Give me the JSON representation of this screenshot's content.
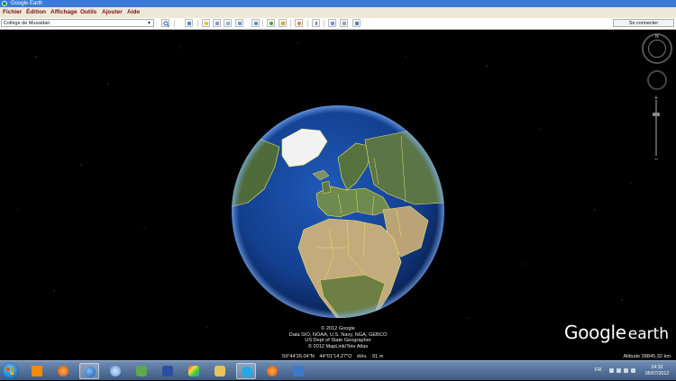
{
  "window": {
    "title": "Google Earth"
  },
  "menu": [
    "Fichier",
    "Édition",
    "Affichage",
    "Outils",
    "Ajouter",
    "Aide"
  ],
  "toolbar": {
    "search_value": "Collège de Mussidan",
    "signin_label": "Se connecter",
    "buttons": [
      "hide-sidebar-icon",
      "placemark-icon",
      "polygon-icon",
      "path-icon",
      "image-overlay-icon",
      "record-tour-icon",
      "historical-imagery-icon",
      "sun-icon",
      "planets-icon",
      "ruler-icon",
      "email-icon",
      "print-icon",
      "maps-icon"
    ]
  },
  "map": {
    "credits": [
      "© 2012 Google",
      "Data SIO, NOAA, U.S. Navy, NGA, GEBCO",
      "US Dept of State Geographer",
      "© 2012 MapLink/Tele Atlas"
    ],
    "latitude": "59°44'26.04\"N",
    "longitude": "44°01'14.27\"O",
    "elevation_label": "élév.",
    "elevation_value": "91 m",
    "altitude": "Altitude 28845.32 km",
    "logo_word1": "Google",
    "logo_word2": "earth",
    "compass_letter": "N"
  },
  "taskbar": {
    "apps": [
      "vlc-icon",
      "firefox-icon",
      "google-earth-icon",
      "itunes-icon",
      "network-icon",
      "installer-icon",
      "paint-icon",
      "explorer-icon",
      "skype-icon",
      "firefox-icon",
      "windows-icon"
    ],
    "language": "FR",
    "time": "14:32",
    "date": "05/07/2012"
  },
  "colors": {
    "title_bar": "#3a7bd5",
    "menu_text": "#7a1111",
    "border_lines": "#f1e86a"
  }
}
